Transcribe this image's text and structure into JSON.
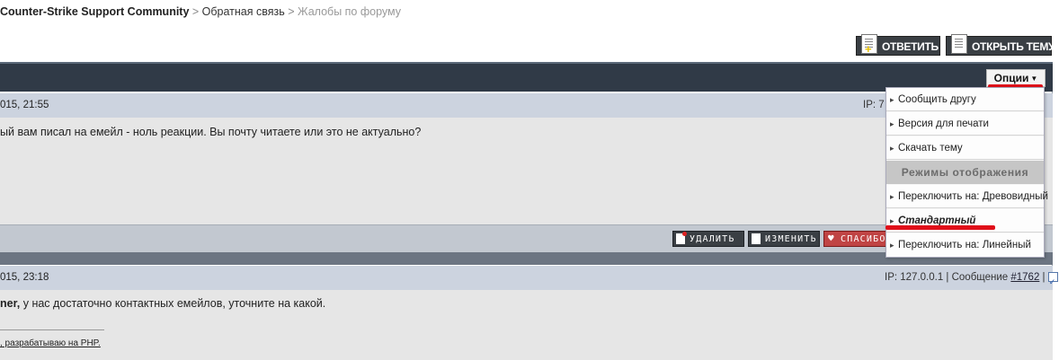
{
  "breadcrumb": {
    "forum": "Counter-Strike Support Community",
    "sep1": " > ",
    "section": "Обратная связь",
    "sep2": " > ",
    "current": "Жалобы по форуму"
  },
  "toolbar": {
    "reply_label": "ОТВЕТИТЬ",
    "new_topic_label": "ОТКРЫТЬ ТЕМУ"
  },
  "options": {
    "button_label": "Опции",
    "menu_items": [
      "Сообщить другу",
      "Версия для печати",
      "Скачать тему"
    ],
    "section_header": "Режимы отображения",
    "view_modes": [
      "Переключить на: Древовидный",
      "Стандартный",
      "Переключить на: Линейный"
    ],
    "selected_mode": "Стандартный"
  },
  "posts": [
    {
      "date": "015, 21:55",
      "ip_prefix": "IP: 7",
      "text": "ый вам писал на емейл - ноль реакции. Вы почту читаете или это не актуально?",
      "actions": {
        "delete_label": "УДАЛИТЬ",
        "edit_label": "ИЗМЕНИТЬ",
        "thanks_label": "СПАСИБО"
      }
    },
    {
      "date": "015, 23:18",
      "ip_text": "IP: 127.0.0.1 | Сообщение ",
      "post_number": "#1762",
      "ip_suffix": " | ",
      "author": "ner,",
      "text": " у нас достаточно контактных емейлов, уточните на какой.",
      "signature": ", разрабатываю на PHP."
    }
  ],
  "colors": {
    "header_bar": "#303a47",
    "post_header": "#ccd3df",
    "post_body": "#e6e6e6",
    "annotation_red": "#e0101a"
  }
}
